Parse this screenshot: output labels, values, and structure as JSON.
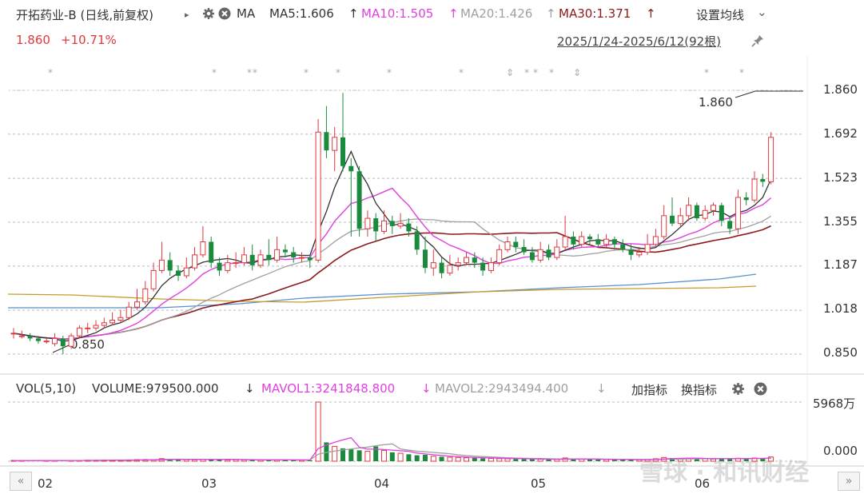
{
  "header": {
    "stock_name": "开拓药业-B (日线,前复权)",
    "arrow": "▸",
    "indicator": "MA",
    "ma5_label": "MA5:1.606",
    "ma10_label": "MA10:1.505",
    "ma20_label": "MA20:1.426",
    "ma30_label": "MA30:1.371",
    "up_arrow": "↑",
    "settings_label": "设置均线",
    "settings_arrow": "⌄",
    "price": "1.860",
    "change": "+10.71%",
    "date_range": "2025/1/24-2025/6/12(92根)"
  },
  "volume_header": {
    "vol_label": "VOL(5,10)",
    "volume_label": "VOLUME:979500.000",
    "mavol1_label": "MAVOL1:3241848.800",
    "mavol2_label": "MAVOL2:2943494.400",
    "down_arrow": "↓",
    "add_indicator": "加指标",
    "switch_indicator": "换指标"
  },
  "y_ticks": [
    "1.860",
    "1.692",
    "1.523",
    "1.355",
    "1.187",
    "1.018",
    "0.850"
  ],
  "vol_ticks": [
    "5968万",
    "0.000"
  ],
  "x_ticks": [
    "02",
    "03",
    "04",
    "05",
    "06"
  ],
  "annotations": {
    "high": "1.860",
    "low": "0.850"
  },
  "watermark": "雪球 · 和讯财经",
  "colors": {
    "up": "#e0393e",
    "down": "#1a8a3c",
    "ma5": "#333333",
    "ma10": "#e040e0",
    "ma20": "#a0a0a0",
    "ma30": "#8b1a1a",
    "ma_long1": "#5b8fd0",
    "ma_long2": "#c89a2a"
  },
  "chart_data": {
    "type": "candlestick",
    "ylim": [
      0.85,
      1.86
    ],
    "vol_ylim": [
      0,
      59680000
    ],
    "x_months": [
      "02",
      "03",
      "04",
      "05",
      "06"
    ],
    "candles": [
      [
        0.93,
        0.93,
        0.95,
        0.91
      ],
      [
        0.92,
        0.92,
        0.94,
        0.91
      ],
      [
        0.92,
        0.91,
        0.93,
        0.9
      ],
      [
        0.91,
        0.9,
        0.92,
        0.89
      ],
      [
        0.9,
        0.9,
        0.91,
        0.89
      ],
      [
        0.89,
        0.91,
        0.93,
        0.88
      ],
      [
        0.91,
        0.88,
        0.92,
        0.85
      ],
      [
        0.88,
        0.92,
        0.93,
        0.87
      ],
      [
        0.92,
        0.95,
        0.96,
        0.91
      ],
      [
        0.95,
        0.95,
        0.97,
        0.93
      ],
      [
        0.95,
        0.96,
        0.98,
        0.94
      ],
      [
        0.96,
        0.97,
        0.99,
        0.95
      ],
      [
        0.97,
        0.98,
        1.01,
        0.96
      ],
      [
        0.98,
        0.99,
        1.02,
        0.97
      ],
      [
        0.99,
        1.03,
        1.05,
        0.98
      ],
      [
        1.03,
        1.05,
        1.1,
        1.02
      ],
      [
        1.05,
        1.1,
        1.13,
        1.04
      ],
      [
        1.1,
        1.17,
        1.2,
        1.09
      ],
      [
        1.17,
        1.21,
        1.28,
        1.16
      ],
      [
        1.21,
        1.17,
        1.24,
        1.15
      ],
      [
        1.17,
        1.15,
        1.19,
        1.13
      ],
      [
        1.15,
        1.18,
        1.22,
        1.14
      ],
      [
        1.18,
        1.23,
        1.26,
        1.17
      ],
      [
        1.23,
        1.28,
        1.34,
        1.22
      ],
      [
        1.28,
        1.2,
        1.3,
        1.18
      ],
      [
        1.2,
        1.17,
        1.22,
        1.15
      ],
      [
        1.17,
        1.2,
        1.23,
        1.16
      ],
      [
        1.2,
        1.2,
        1.24,
        1.18
      ],
      [
        1.2,
        1.23,
        1.26,
        1.19
      ],
      [
        1.23,
        1.19,
        1.27,
        1.17
      ],
      [
        1.19,
        1.23,
        1.25,
        1.18
      ],
      [
        1.23,
        1.21,
        1.29,
        1.19
      ],
      [
        1.21,
        1.25,
        1.3,
        1.2
      ],
      [
        1.25,
        1.24,
        1.27,
        1.22
      ],
      [
        1.24,
        1.22,
        1.26,
        1.2
      ],
      [
        1.22,
        1.22,
        1.24,
        1.2
      ],
      [
        1.22,
        1.21,
        1.23,
        1.18
      ],
      [
        1.21,
        1.7,
        1.75,
        1.2
      ],
      [
        1.7,
        1.63,
        1.8,
        1.6
      ],
      [
        1.63,
        1.68,
        1.72,
        1.55
      ],
      [
        1.68,
        1.57,
        1.85,
        1.55
      ],
      [
        1.57,
        1.55,
        1.6,
        1.3
      ],
      [
        1.55,
        1.33,
        1.57,
        1.3
      ],
      [
        1.33,
        1.37,
        1.4,
        1.3
      ],
      [
        1.37,
        1.32,
        1.39,
        1.28
      ],
      [
        1.32,
        1.36,
        1.4,
        1.31
      ],
      [
        1.36,
        1.34,
        1.38,
        1.31
      ],
      [
        1.34,
        1.35,
        1.39,
        1.33
      ],
      [
        1.35,
        1.32,
        1.37,
        1.3
      ],
      [
        1.32,
        1.25,
        1.34,
        1.23
      ],
      [
        1.25,
        1.18,
        1.3,
        1.16
      ],
      [
        1.18,
        1.2,
        1.25,
        1.15
      ],
      [
        1.2,
        1.16,
        1.22,
        1.14
      ],
      [
        1.16,
        1.19,
        1.23,
        1.15
      ],
      [
        1.19,
        1.2,
        1.22,
        1.17
      ],
      [
        1.2,
        1.22,
        1.24,
        1.19
      ],
      [
        1.22,
        1.2,
        1.24,
        1.18
      ],
      [
        1.2,
        1.17,
        1.22,
        1.15
      ],
      [
        1.17,
        1.2,
        1.22,
        1.16
      ],
      [
        1.2,
        1.25,
        1.27,
        1.19
      ],
      [
        1.25,
        1.28,
        1.3,
        1.24
      ],
      [
        1.28,
        1.26,
        1.3,
        1.24
      ],
      [
        1.26,
        1.24,
        1.29,
        1.23
      ],
      [
        1.24,
        1.21,
        1.26,
        1.2
      ],
      [
        1.21,
        1.25,
        1.28,
        1.2
      ],
      [
        1.25,
        1.22,
        1.27,
        1.21
      ],
      [
        1.22,
        1.26,
        1.29,
        1.21
      ],
      [
        1.26,
        1.3,
        1.38,
        1.25
      ],
      [
        1.3,
        1.27,
        1.32,
        1.25
      ],
      [
        1.27,
        1.3,
        1.32,
        1.26
      ],
      [
        1.3,
        1.29,
        1.31,
        1.27
      ],
      [
        1.29,
        1.27,
        1.31,
        1.26
      ],
      [
        1.27,
        1.29,
        1.31,
        1.26
      ],
      [
        1.29,
        1.27,
        1.3,
        1.25
      ],
      [
        1.27,
        1.25,
        1.29,
        1.24
      ],
      [
        1.25,
        1.23,
        1.27,
        1.21
      ],
      [
        1.23,
        1.24,
        1.26,
        1.22
      ],
      [
        1.24,
        1.27,
        1.31,
        1.23
      ],
      [
        1.27,
        1.3,
        1.33,
        1.26
      ],
      [
        1.3,
        1.38,
        1.42,
        1.29
      ],
      [
        1.38,
        1.35,
        1.45,
        1.34
      ],
      [
        1.35,
        1.38,
        1.41,
        1.34
      ],
      [
        1.38,
        1.42,
        1.45,
        1.36
      ],
      [
        1.42,
        1.37,
        1.43,
        1.36
      ],
      [
        1.37,
        1.4,
        1.42,
        1.36
      ],
      [
        1.4,
        1.42,
        1.43,
        1.38
      ],
      [
        1.42,
        1.36,
        1.43,
        1.34
      ],
      [
        1.36,
        1.33,
        1.38,
        1.31
      ],
      [
        1.33,
        1.45,
        1.48,
        1.31
      ],
      [
        1.45,
        1.44,
        1.47,
        1.42
      ],
      [
        1.44,
        1.52,
        1.55,
        1.43
      ],
      [
        1.52,
        1.51,
        1.54,
        1.49
      ],
      [
        1.51,
        1.68,
        1.7,
        1.5
      ]
    ],
    "volumes_wan": [
      50,
      60,
      70,
      80,
      60,
      70,
      90,
      80,
      70,
      100,
      90,
      110,
      100,
      120,
      130,
      160,
      170,
      150,
      260,
      240,
      180,
      150,
      140,
      200,
      230,
      170,
      130,
      150,
      140,
      130,
      120,
      140,
      160,
      120,
      100,
      110,
      100,
      5968,
      1900,
      1500,
      1300,
      1200,
      1100,
      1000,
      1500,
      1100,
      900,
      800,
      700,
      600,
      650,
      500,
      450,
      400,
      380,
      350,
      330,
      300,
      280,
      260,
      250,
      230,
      210,
      220,
      200,
      180,
      190,
      330,
      220,
      200,
      190,
      180,
      170,
      160,
      150,
      140,
      160,
      200,
      250,
      380,
      320,
      280,
      300,
      260,
      240,
      220,
      250,
      260,
      300,
      280,
      320,
      300,
      430
    ],
    "series": [
      {
        "name": "MA5",
        "values": [
          1.606
        ]
      },
      {
        "name": "MA10",
        "values": [
          1.505
        ]
      },
      {
        "name": "MA20",
        "values": [
          1.426
        ]
      },
      {
        "name": "MA30",
        "values": [
          1.371
        ]
      }
    ],
    "high_mark": 1.86,
    "low_mark": 0.85
  }
}
